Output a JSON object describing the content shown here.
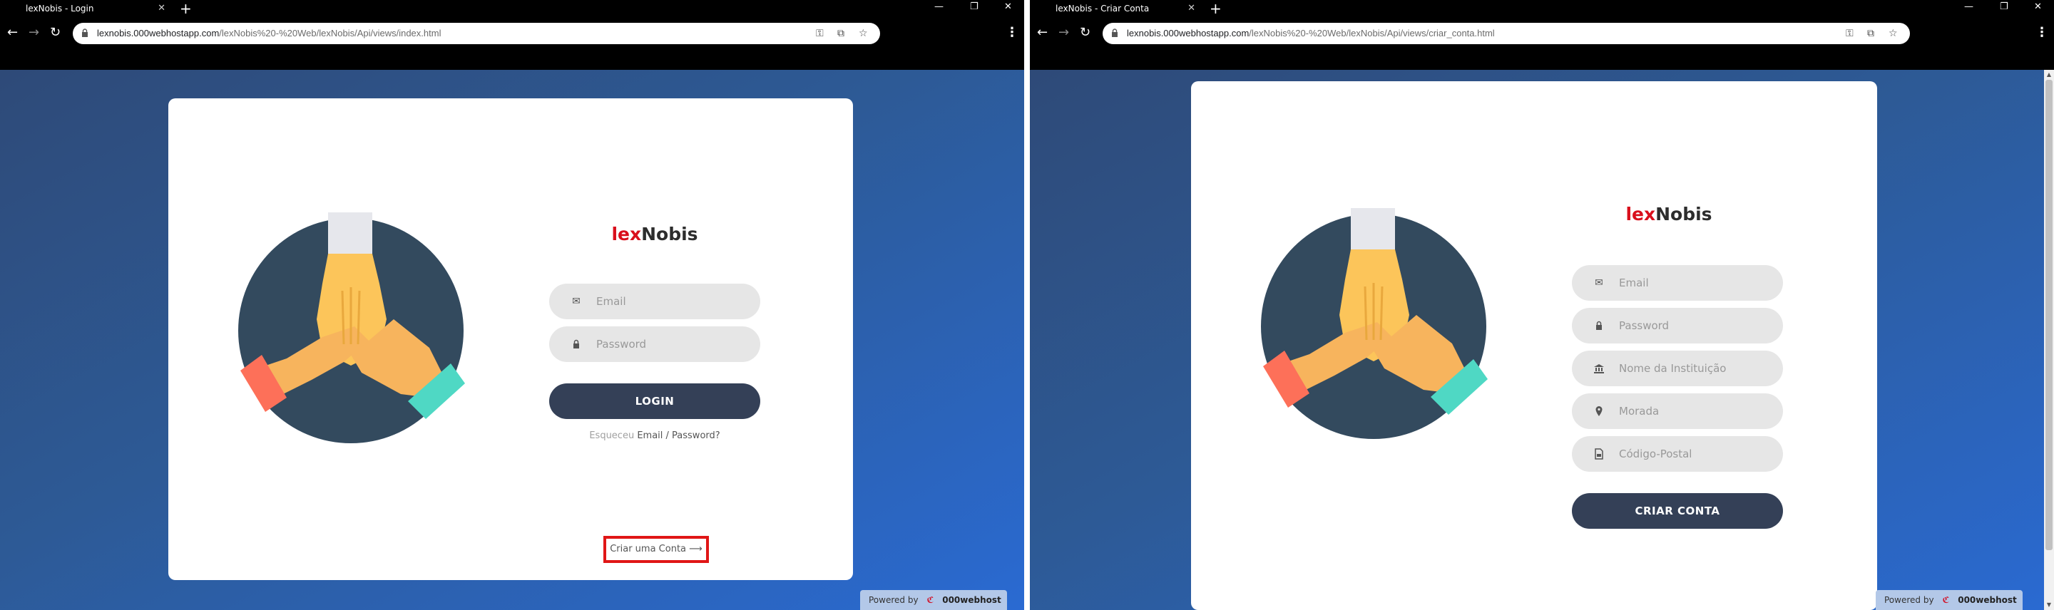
{
  "left": {
    "tab_title": "lexNobis - Login",
    "url_host": "lexnobis.000webhostapp.com",
    "url_path": "/lexNobis%20-%20Web/lexNobis/Api/views/index.html",
    "brand_a": "lex",
    "brand_b": "Nobis",
    "email_placeholder": "Email",
    "password_placeholder": "Password",
    "login_button": "LOGIN",
    "forgot_a": "Esqueceu ",
    "forgot_b": "Email / Password?",
    "create_account": "Criar uma Conta",
    "powered_by": "Powered by",
    "powered_brand": "000webhost"
  },
  "right": {
    "tab_title": "lexNobis - Criar Conta",
    "url_host": "lexnobis.000webhostapp.com",
    "url_path": "/lexNobis%20-%20Web/lexNobis/Api/views/criar_conta.html",
    "brand_a": "lex",
    "brand_b": "Nobis",
    "email_placeholder": "Email",
    "password_placeholder": "Password",
    "institution_placeholder": "Nome da Instituição",
    "address_placeholder": "Morada",
    "postal_placeholder": "Código-Postal",
    "create_button": "CRIAR CONTA",
    "powered_by": "Powered by",
    "powered_brand": "000webhost"
  },
  "colors": {
    "brand_red": "#d90f1c",
    "button_dark": "#344057",
    "highlight_red": "#e01616"
  },
  "icons": [
    "envelope-icon",
    "lock-icon",
    "bank-icon",
    "map-marker-icon",
    "document-icon",
    "arrow-right-icon",
    "key-icon",
    "translate-icon",
    "star-icon"
  ]
}
